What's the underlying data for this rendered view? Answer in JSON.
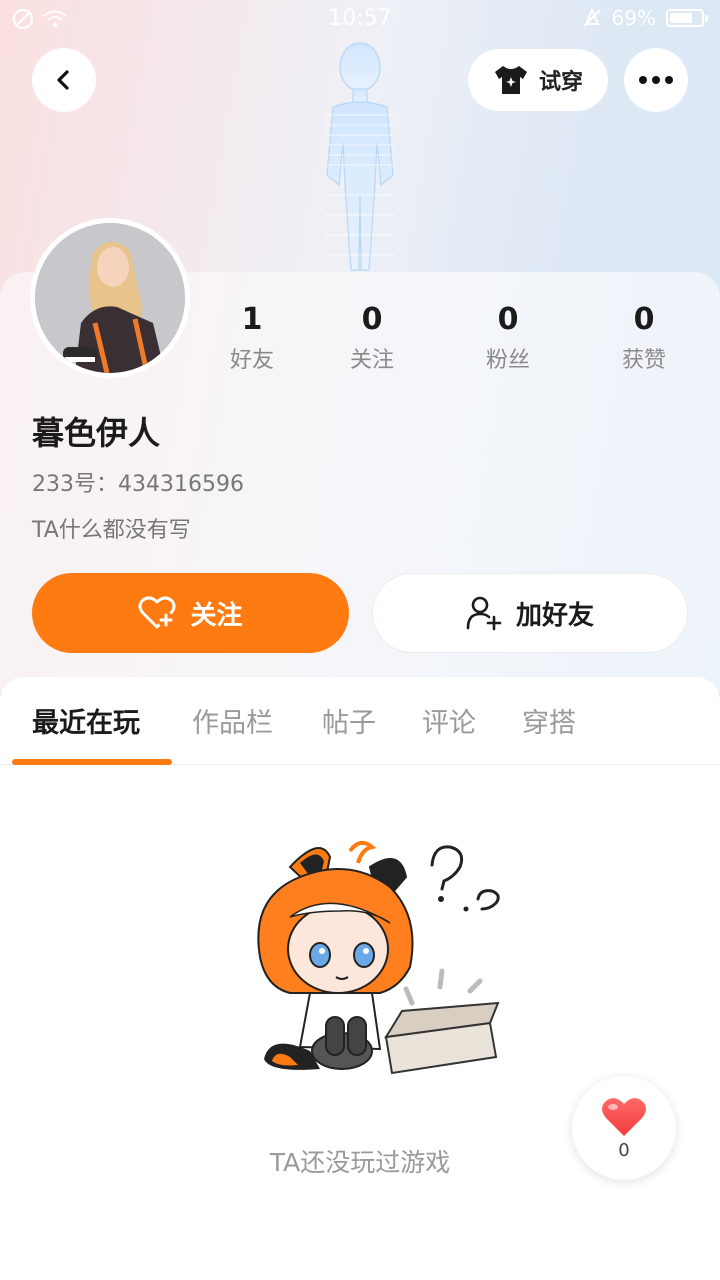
{
  "status_bar": {
    "time": "10:57",
    "battery": "69%"
  },
  "header": {
    "tryon_label": "试穿"
  },
  "profile": {
    "nickname": "暮色伊人",
    "uid": "233号：434316596",
    "bio": "TA什么都没有写"
  },
  "stats": [
    {
      "value": "1",
      "label": "好友"
    },
    {
      "value": "0",
      "label": "关注"
    },
    {
      "value": "0",
      "label": "粉丝"
    },
    {
      "value": "0",
      "label": "获赞"
    }
  ],
  "actions": {
    "follow_label": "关注",
    "add_friend_label": "加好友"
  },
  "tabs": [
    {
      "label": "最近在玩",
      "active": true
    },
    {
      "label": "作品栏",
      "active": false
    },
    {
      "label": "帖子",
      "active": false
    },
    {
      "label": "评论",
      "active": false
    },
    {
      "label": "穿搭",
      "active": false
    }
  ],
  "empty_state": {
    "text": "TA还没玩过游戏"
  },
  "like_fab": {
    "count": "0"
  },
  "colors": {
    "accent": "#ff7a10",
    "like_red": "#ff4a4a"
  },
  "icons": [
    "back-icon",
    "tshirt-icon",
    "more-icon",
    "heart-plus-icon",
    "add-user-icon",
    "heart-icon"
  ]
}
